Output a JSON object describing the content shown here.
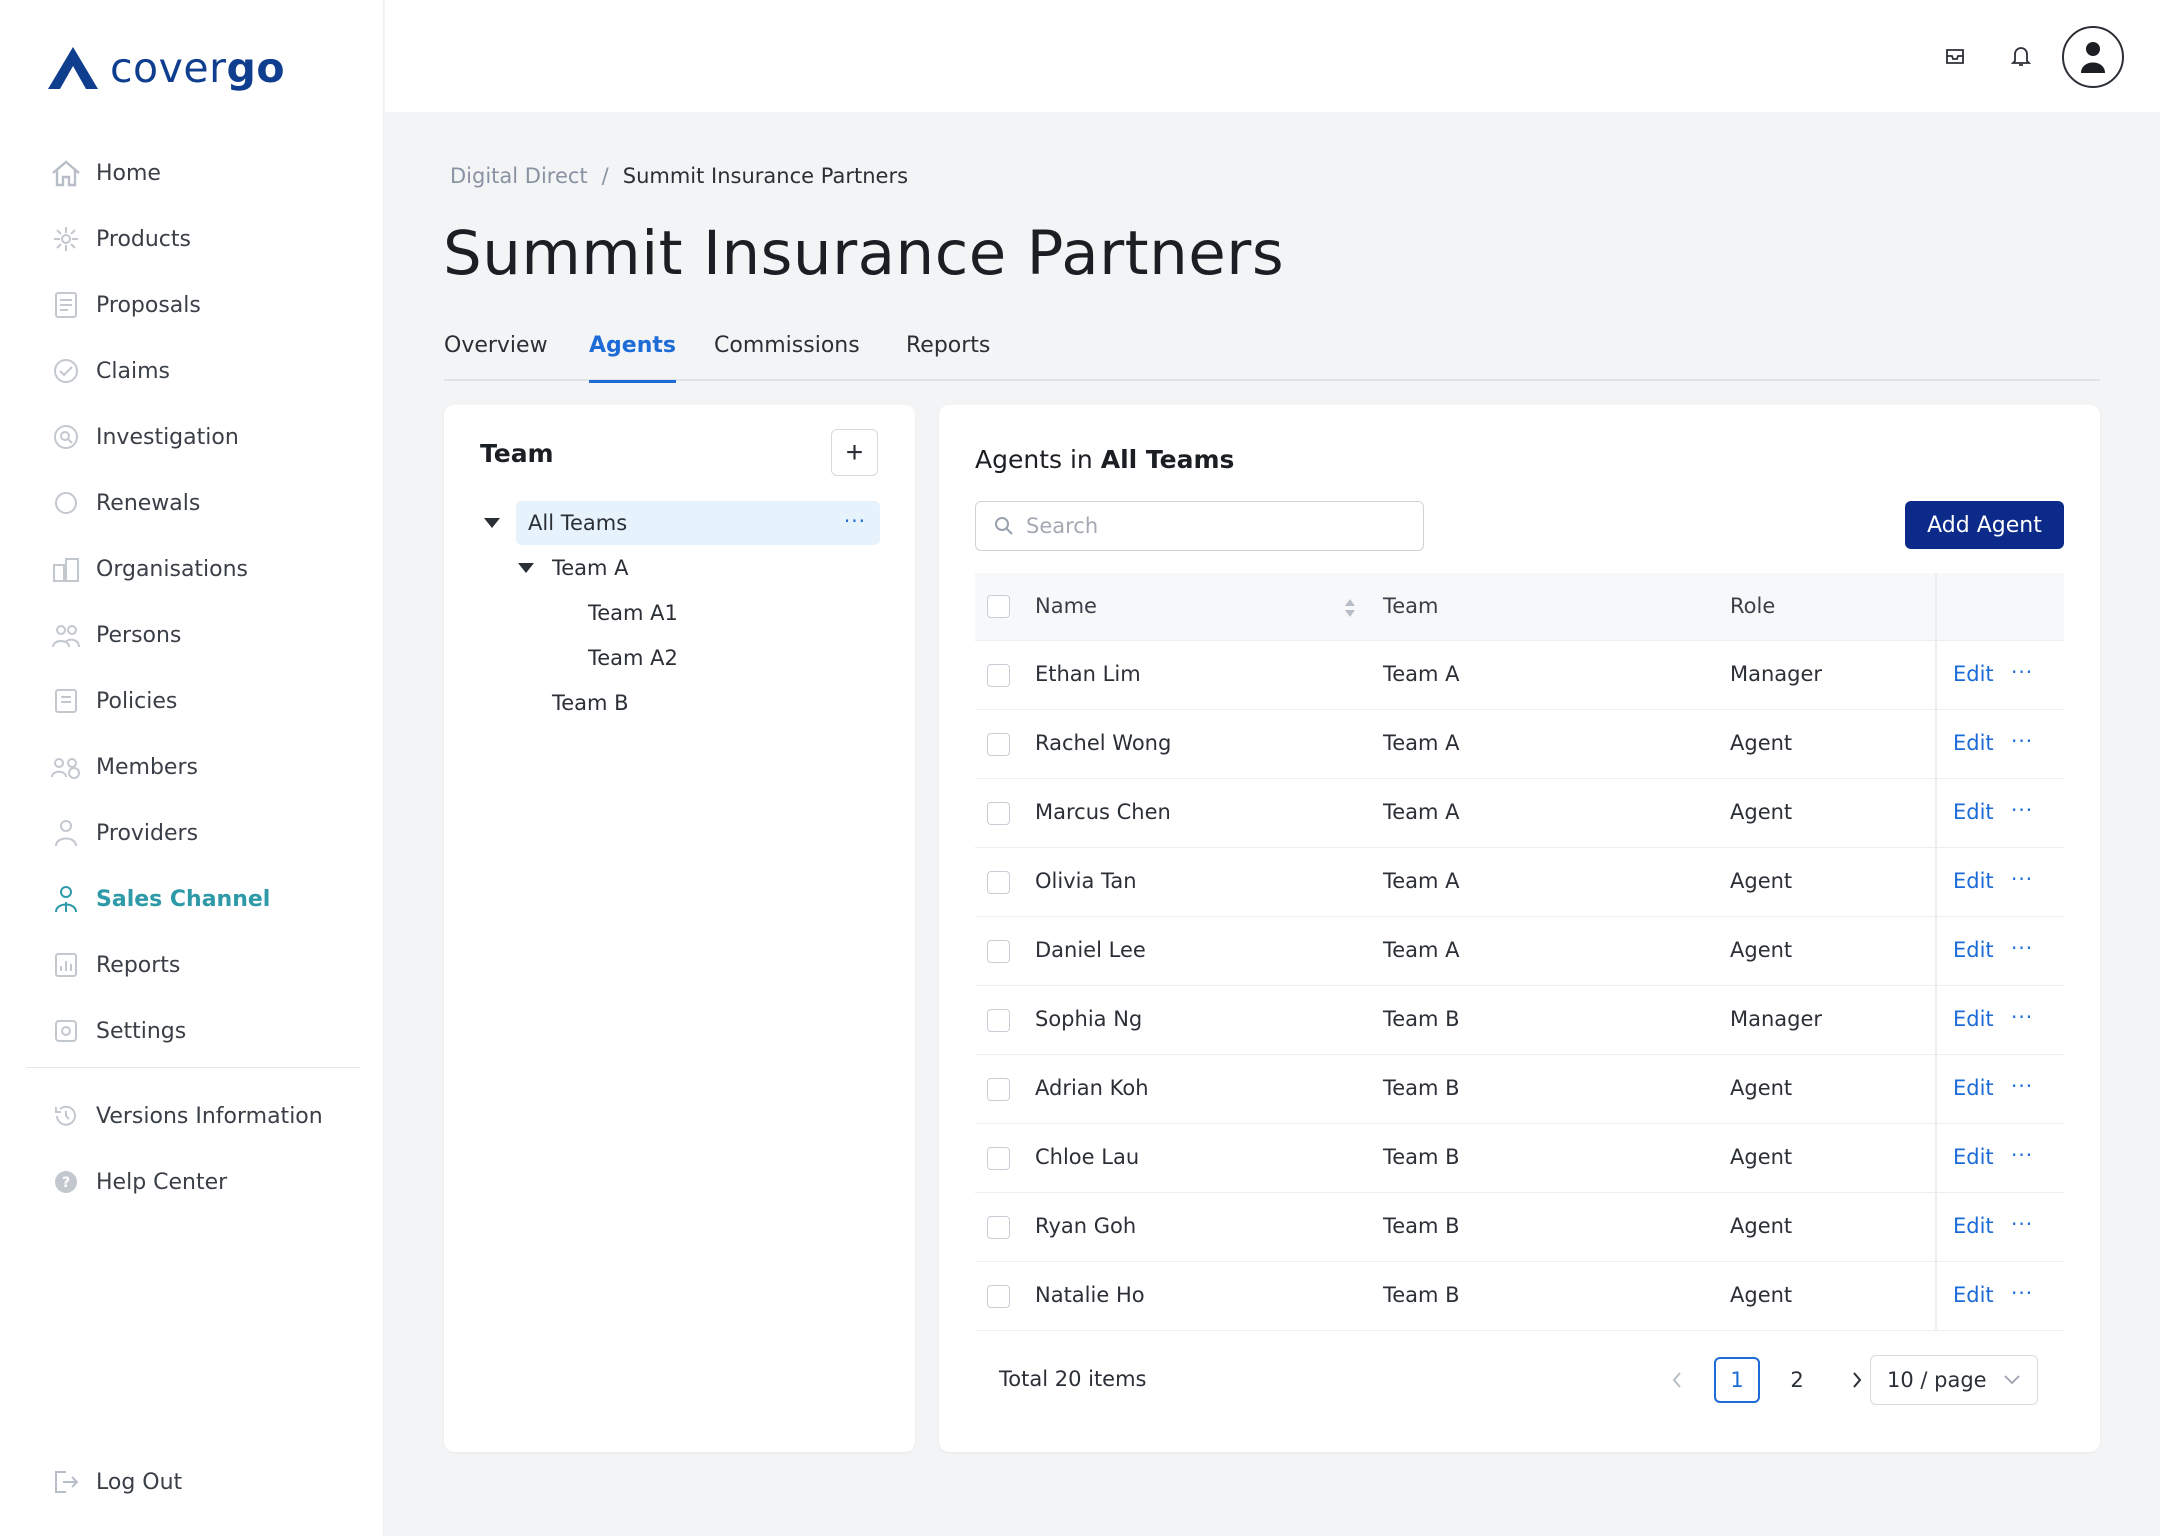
{
  "brand": {
    "logo_text_light": "cover",
    "logo_text_bold": "go",
    "color": "#103e8f"
  },
  "sidebar": {
    "items": [
      {
        "label": "Home",
        "icon": "home-icon"
      },
      {
        "label": "Products",
        "icon": "products-icon"
      },
      {
        "label": "Proposals",
        "icon": "proposals-icon"
      },
      {
        "label": "Claims",
        "icon": "claims-icon"
      },
      {
        "label": "Investigation",
        "icon": "investigation-icon"
      },
      {
        "label": "Renewals",
        "icon": "renewals-icon"
      },
      {
        "label": "Organisations",
        "icon": "organisations-icon"
      },
      {
        "label": "Persons",
        "icon": "persons-icon"
      },
      {
        "label": "Policies",
        "icon": "policies-icon"
      },
      {
        "label": "Members",
        "icon": "members-icon"
      },
      {
        "label": "Providers",
        "icon": "providers-icon"
      },
      {
        "label": "Sales Channel",
        "icon": "sales-channel-icon",
        "active": true
      },
      {
        "label": "Reports",
        "icon": "reports-icon"
      },
      {
        "label": "Settings",
        "icon": "settings-icon"
      }
    ],
    "secondary": [
      {
        "label": "Versions Information",
        "icon": "history-icon"
      },
      {
        "label": "Help Center",
        "icon": "help-icon"
      }
    ],
    "logout": {
      "label": "Log Out",
      "icon": "logout-icon"
    },
    "active_color": "#2e9aa8"
  },
  "header": {
    "icons": [
      "inbox-icon",
      "bell-icon",
      "user-avatar-icon"
    ]
  },
  "breadcrumb": {
    "parent": "Digital Direct",
    "separator": "/",
    "current": "Summit Insurance Partners"
  },
  "page_title": "Summit Insurance Partners",
  "tabs": [
    {
      "label": "Overview"
    },
    {
      "label": "Agents",
      "active": true
    },
    {
      "label": "Commissions"
    },
    {
      "label": "Reports"
    }
  ],
  "team_panel": {
    "title": "Team",
    "add_label": "+",
    "tree": [
      {
        "label": "All Teams",
        "selected": true,
        "expanded": true
      },
      {
        "label": "Team A",
        "expanded": true
      },
      {
        "label": "Team A1"
      },
      {
        "label": "Team A2"
      },
      {
        "label": "Team B"
      }
    ],
    "more_label": "···"
  },
  "agents_panel": {
    "title_prefix": "Agents in",
    "title_scope": "All Teams",
    "search_placeholder": "Search",
    "add_button": "Add Agent",
    "columns": {
      "name": "Name",
      "team": "Team",
      "role": "Role"
    },
    "edit_label": "Edit",
    "more_label": "···",
    "rows": [
      {
        "name": "Ethan Lim",
        "team": "Team A",
        "role": "Manager"
      },
      {
        "name": "Rachel Wong",
        "team": "Team A",
        "role": "Agent"
      },
      {
        "name": "Marcus Chen",
        "team": "Team A",
        "role": "Agent"
      },
      {
        "name": "Olivia Tan",
        "team": "Team A",
        "role": "Agent"
      },
      {
        "name": "Daniel Lee",
        "team": "Team A",
        "role": "Agent"
      },
      {
        "name": "Sophia Ng",
        "team": "Team B",
        "role": "Manager"
      },
      {
        "name": "Adrian Koh",
        "team": "Team B",
        "role": "Agent"
      },
      {
        "name": "Chloe Lau",
        "team": "Team B",
        "role": "Agent"
      },
      {
        "name": "Ryan Goh",
        "team": "Team B",
        "role": "Agent"
      },
      {
        "name": "Natalie Ho",
        "team": "Team B",
        "role": "Agent"
      }
    ],
    "pagination": {
      "total": "Total 20 items",
      "pages": [
        "1",
        "2"
      ],
      "current": "1",
      "page_size": "10 / page"
    }
  },
  "colors": {
    "accent": "#1c6bd6",
    "primary_button": "#0b2a8a",
    "selected_bg": "#e6f2fc",
    "page_bg": "#f3f4f6"
  }
}
